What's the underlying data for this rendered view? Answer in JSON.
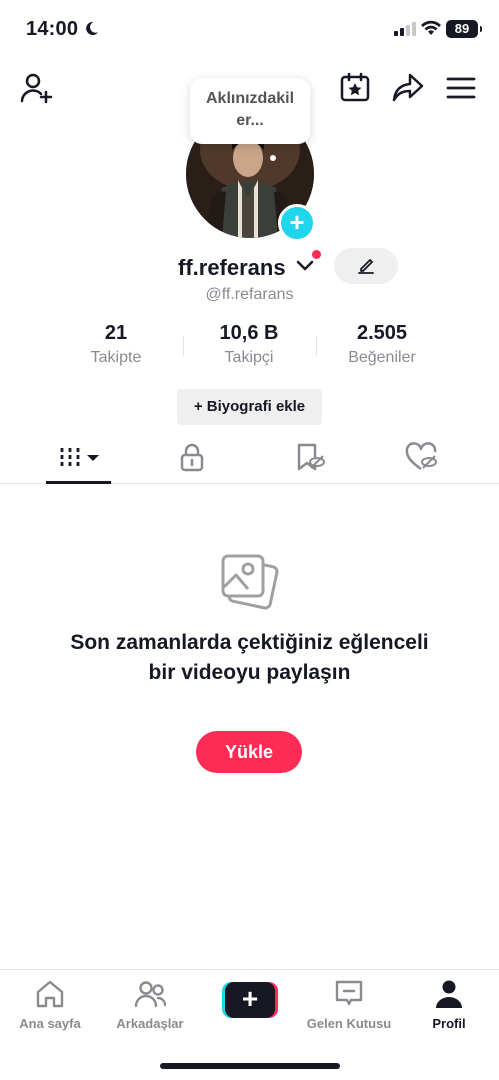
{
  "status_bar": {
    "time": "14:00",
    "battery": "89"
  },
  "profile": {
    "thought_bubble": "Aklınızdakil er...",
    "username": "ff.referans",
    "handle": "@ff.refarans",
    "stats": [
      {
        "value": "21",
        "label": "Takipte"
      },
      {
        "value": "10,6 B",
        "label": "Takipçi"
      },
      {
        "value": "2.505",
        "label": "Beğeniler"
      }
    ],
    "bio_button": "+ Biyografi ekle"
  },
  "empty_state": {
    "message": "Son zamanlarda çektiğiniz eğlenceli bir videoyu paylaşın",
    "upload_button": "Yükle"
  },
  "bottom_nav": [
    {
      "label": "Ana sayfa",
      "icon": "home-icon"
    },
    {
      "label": "Arkadaşlar",
      "icon": "friends-icon"
    },
    {
      "label": "",
      "icon": "create-icon"
    },
    {
      "label": "Gelen Kutusu",
      "icon": "inbox-icon"
    },
    {
      "label": "Profil",
      "icon": "profile-icon"
    }
  ],
  "colors": {
    "accent": "#fe2c55",
    "cyan": "#20d5ec",
    "text": "#161823",
    "muted": "#8a8b91"
  }
}
